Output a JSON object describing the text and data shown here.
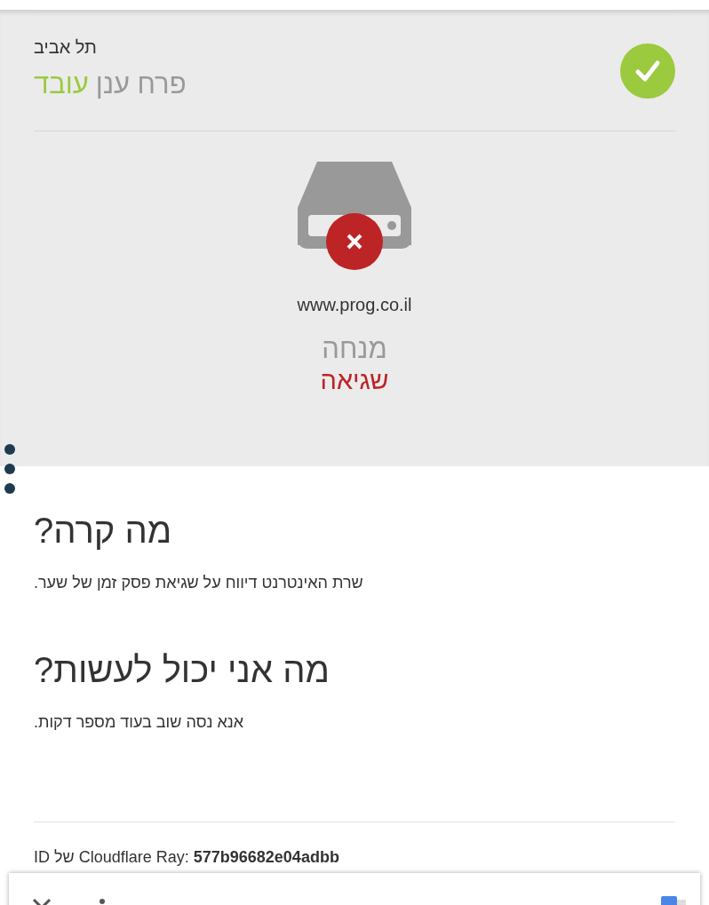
{
  "status_panel": {
    "location": "תל אביב",
    "service": "פרח ענן",
    "status": {
      "label": "עובד",
      "kind": "ok"
    },
    "host": {
      "domain": "www.prog.co.il",
      "name": "מנחה",
      "status": {
        "label": "שגיאה",
        "kind": "error"
      }
    }
  },
  "sections": [
    {
      "heading": "מה קרה?",
      "text": "שרת האינטרנט דיווח על שגיאת פסק זמן של שער."
    },
    {
      "heading": "מה אני יכול לעשות?",
      "text": "אנא נסה שוב בעוד מספר דקות."
    }
  ],
  "footer": {
    "ray_id": "ID של Cloudflare Ray: **577b96682e04adbb**"
  }
}
